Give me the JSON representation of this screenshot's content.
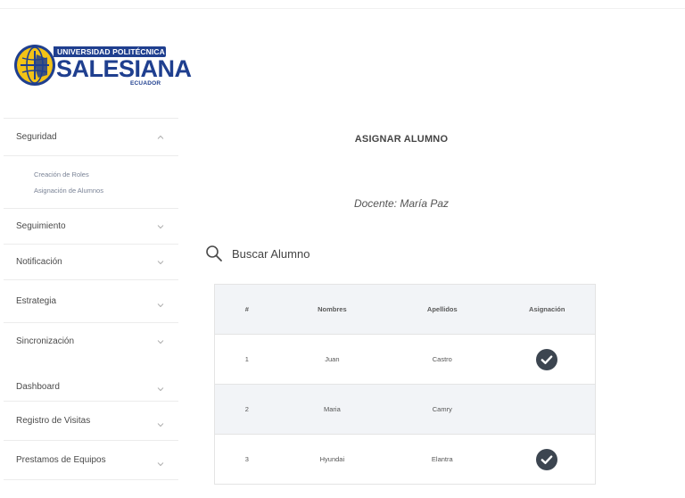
{
  "logo": {
    "university": "UNIVERSIDAD POLITÉCNICA",
    "name": "SALESIANA",
    "country": "ECUADOR"
  },
  "sidebar": {
    "items": [
      {
        "label": "Seguridad",
        "expanded": true,
        "subitems": [
          "Creación de Roles",
          "Asignación de Alumnos"
        ]
      },
      {
        "label": "Seguimiento",
        "expanded": false
      },
      {
        "label": "Notificación",
        "expanded": false
      },
      {
        "label": "Estrategia",
        "expanded": false
      },
      {
        "label": "Sincronización",
        "expanded": false
      },
      {
        "label": "Dashboard",
        "expanded": false
      },
      {
        "label": "Registro de Visitas",
        "expanded": false
      },
      {
        "label": "Prestamos de Equipos",
        "expanded": false
      }
    ]
  },
  "main": {
    "title": "ASIGNAR ALUMNO",
    "docente": "Docente: María Paz",
    "search_label": "Buscar Alumno"
  },
  "table": {
    "headers": [
      "#",
      "Nombres",
      "Apellidos",
      "Asignación"
    ],
    "rows": [
      {
        "num": "1",
        "nombres": "Juan",
        "apellidos": "Castro",
        "asignado": true
      },
      {
        "num": "2",
        "nombres": "Maria",
        "apellidos": "Camry",
        "asignado": false
      },
      {
        "num": "3",
        "nombres": "Hyundai",
        "apellidos": "Elantra",
        "asignado": true
      }
    ]
  },
  "colors": {
    "brand_blue": "#1f3f8f",
    "brand_yellow": "#f3c316",
    "check_bg": "#3c4550",
    "header_bg": "#f2f4f7"
  },
  "icons": {
    "search": "search-icon",
    "chevron": "chevron-icon",
    "check": "check-circle-icon"
  }
}
